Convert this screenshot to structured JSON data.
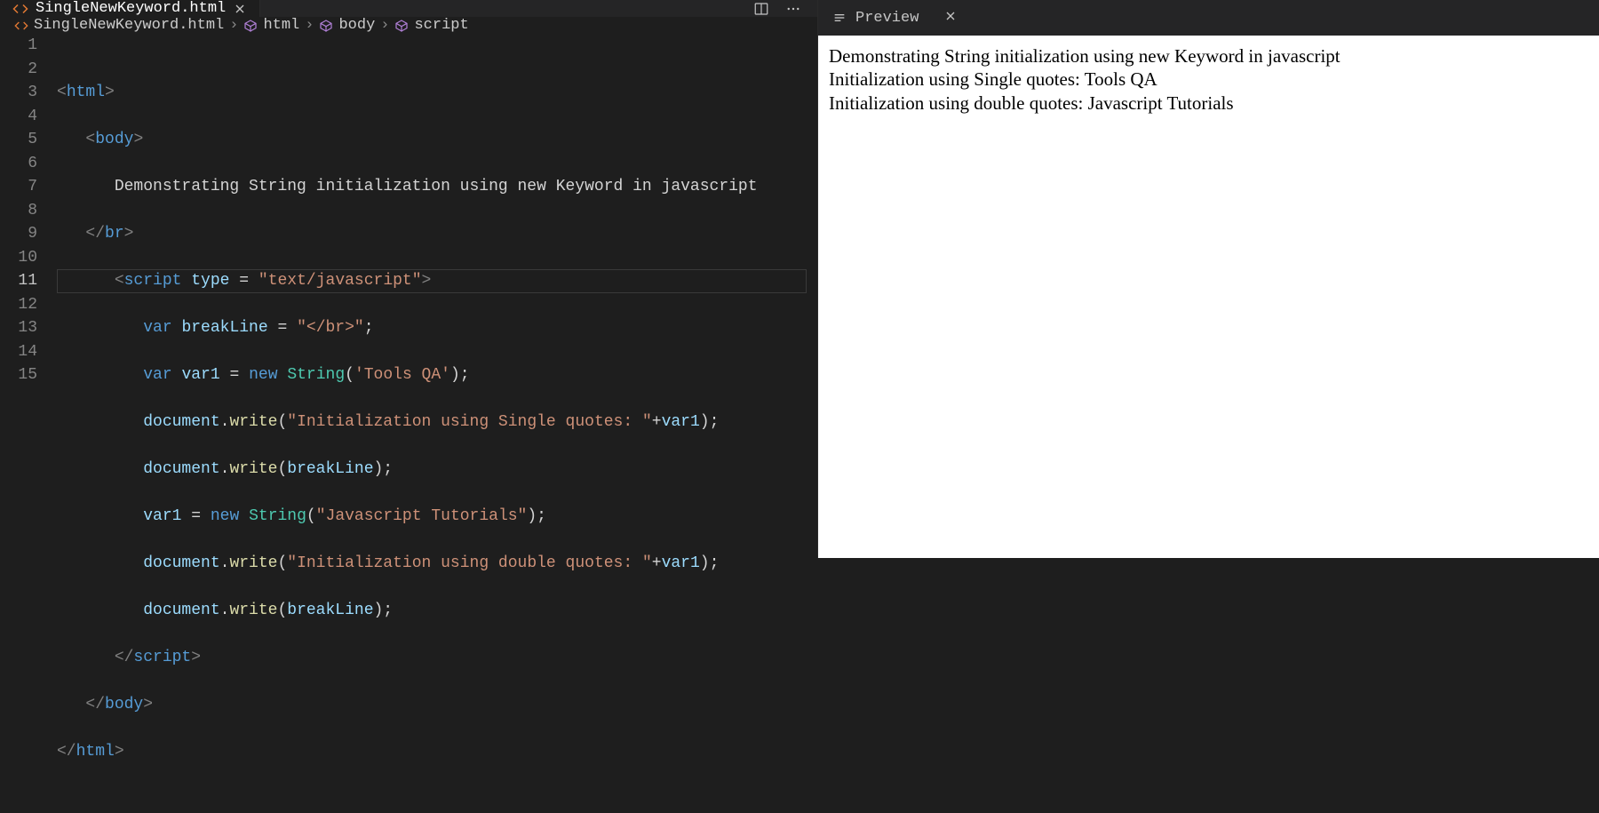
{
  "tabs": {
    "file": "SingleNewKeyword.html"
  },
  "breadcrumbs": {
    "file": "SingleNewKeyword.html",
    "html": "html",
    "body": "body",
    "script": "script"
  },
  "gutter": [
    "1",
    "2",
    "3",
    "4",
    "5",
    "6",
    "7",
    "8",
    "9",
    "10",
    "11",
    "12",
    "13",
    "14",
    "15"
  ],
  "code": {
    "l3_text": "Demonstrating String initialization using new Keyword in javascript",
    "attr_type": "type",
    "val_type": "\"text/javascript\"",
    "var_kw": "var",
    "new_kw": "new",
    "breakLine": "breakLine",
    "breakLineVal": "\"</br>\"",
    "var1": "var1",
    "String": "String",
    "toolsqa": "'Tools QA'",
    "document": "document",
    "write": "write",
    "msg1": "\"Initialization using Single quotes: \"",
    "jsTut": "\"Javascript Tutorials\"",
    "msg2": "\"Initialization using double quotes: \"",
    "tag_html": "html",
    "tag_body": "body",
    "tag_br": "br",
    "tag_script": "script"
  },
  "preview": {
    "tab": "Preview",
    "line1": "Demonstrating String initialization using new Keyword in javascript",
    "line2": "Initialization using Single quotes: Tools QA",
    "line3": "Initialization using double quotes: Javascript Tutorials"
  }
}
